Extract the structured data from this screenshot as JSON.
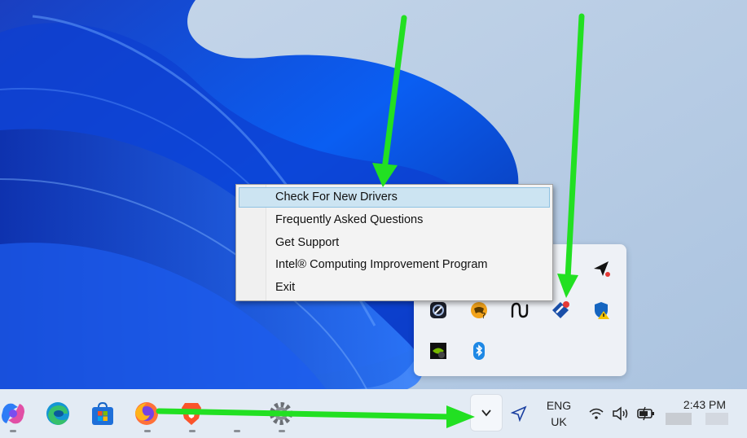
{
  "context_menu": {
    "items": [
      {
        "label": "Check For New Drivers",
        "highlighted": true
      },
      {
        "label": "Frequently Asked Questions"
      },
      {
        "label": "Get Support"
      },
      {
        "label": "Intel® Computing Improvement Program"
      },
      {
        "label": "Exit"
      }
    ]
  },
  "tray_flyout": {
    "icons": [
      "send-arrow-icon",
      "disk-sync-icon",
      "game-controller-help-icon",
      "waveform-icon",
      "intel-driver-assistant-icon",
      "security-warning-shield-icon",
      "nvidia-update-icon",
      "bluetooth-icon"
    ]
  },
  "taskbar": {
    "apps": [
      "copilot-icon",
      "edge-icon",
      "store-icon",
      "firefox-icon",
      "brave-icon",
      "settings-icon"
    ],
    "language": {
      "line1": "ENG",
      "line2": "UK"
    },
    "clock": {
      "time": "2:43 PM"
    }
  },
  "colors": {
    "annotation_arrow": "#22e022",
    "menu_highlight": "#cce4f2",
    "taskbar": "#e3ebf4"
  }
}
